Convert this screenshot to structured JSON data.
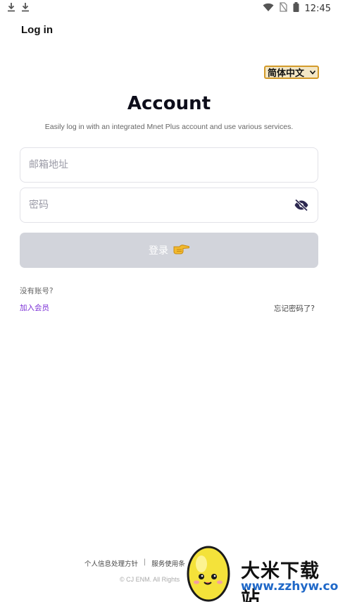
{
  "status_bar": {
    "time": "12:45"
  },
  "header": {
    "title": "Log in"
  },
  "language": {
    "selected": "简体中文"
  },
  "main": {
    "title": "Account",
    "subtitle": "Easily log in with an integrated Mnet Plus account and use various services.",
    "email": {
      "placeholder": "邮箱地址",
      "value": ""
    },
    "password": {
      "placeholder": "密码",
      "value": ""
    },
    "login_label": "登录",
    "no_account": "没有账号?",
    "join": "加入会员",
    "forgot": "忘记密码了?"
  },
  "footer": {
    "privacy": "个人信息处理方针",
    "separator": "|",
    "terms": "服务使用条",
    "copyright": "© CJ ENM. All Rights"
  },
  "watermark": {
    "name": "大米下载站",
    "url": "www.zzhyw.com"
  },
  "colors": {
    "accent": "#7b2fd6",
    "button_disabled": "#d2d4db",
    "select_border": "#d39a2a"
  },
  "icons": [
    "download-icon",
    "wifi-icon",
    "no-sim-icon",
    "battery-icon",
    "eye-off-icon",
    "pointing-hand-icon"
  ]
}
